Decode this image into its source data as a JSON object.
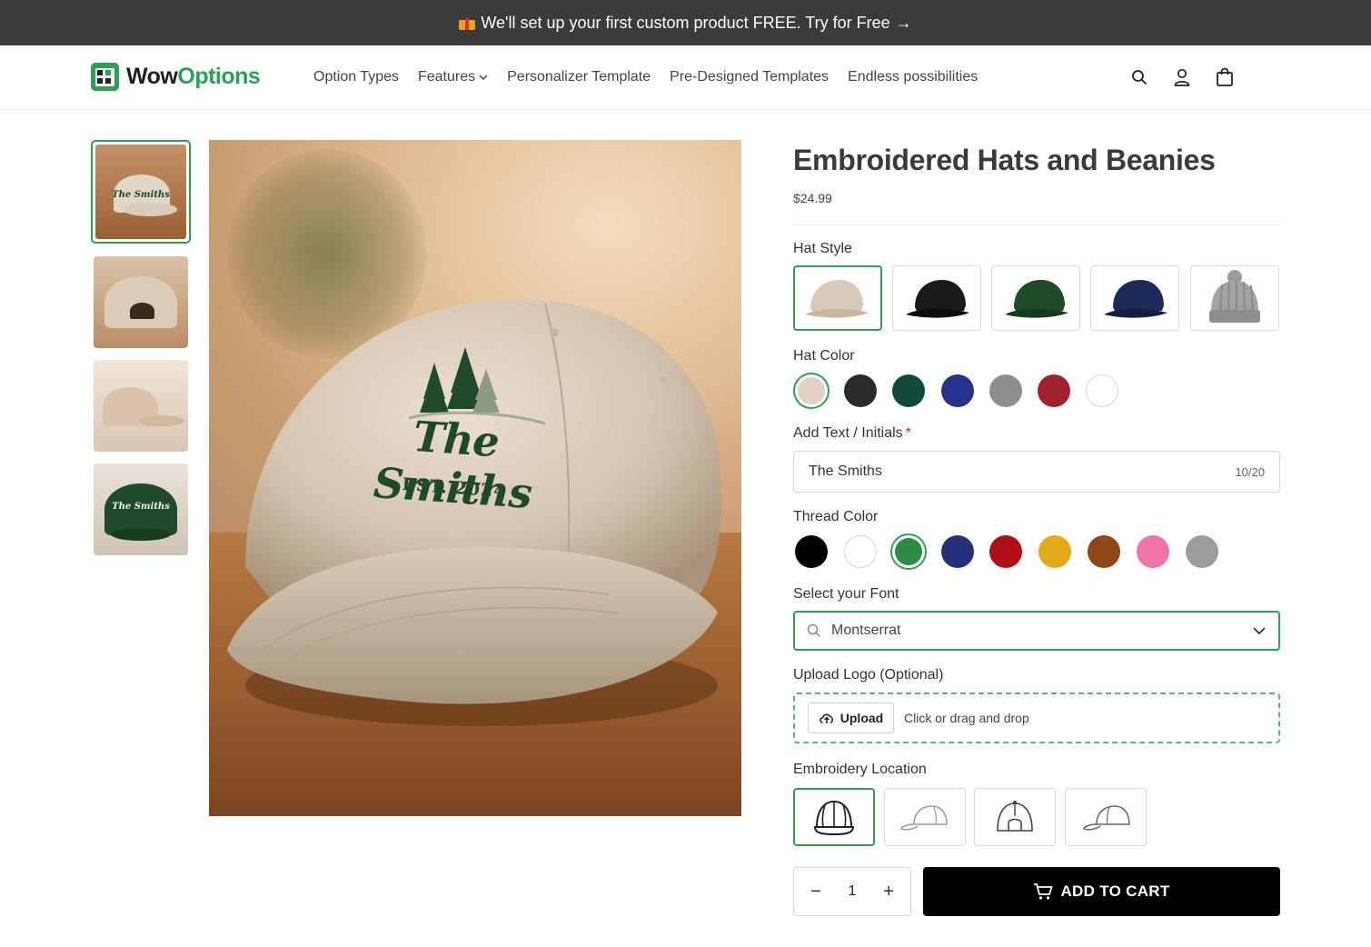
{
  "announcement": {
    "text": "We'll set up your first custom product FREE. Try for Free",
    "arrow": "→"
  },
  "brand": {
    "name_part1": "Wow",
    "name_part2": "Options",
    "accent": "#2f9e56"
  },
  "nav": {
    "items": [
      {
        "label": "Option Types"
      },
      {
        "label": "Features",
        "has_dropdown": true
      },
      {
        "label": "Personalizer Template"
      },
      {
        "label": "Pre-Designed Templates"
      },
      {
        "label": "Endless possibilities"
      }
    ],
    "icons": [
      "search-icon",
      "account-icon",
      "cart-bag-icon"
    ]
  },
  "gallery": {
    "thumbnails": [
      {
        "alt": "Beige cap front",
        "selected": true,
        "caption": "The Smiths"
      },
      {
        "alt": "Beige cap back",
        "selected": false,
        "caption": ""
      },
      {
        "alt": "Beige cap side",
        "selected": false,
        "caption": ""
      },
      {
        "alt": "Green cap front",
        "selected": false,
        "caption": "The Smiths"
      }
    ],
    "main": {
      "embroidery_text": "The Smiths",
      "embroidery_sub": "EST. 2024"
    }
  },
  "product": {
    "title": "Embroidered Hats and Beanies",
    "price": "$24.99"
  },
  "options": {
    "hat_style": {
      "label": "Hat Style",
      "choices": [
        {
          "name": "beige-cap",
          "color": "#d8cab8",
          "selected": true
        },
        {
          "name": "black-cap",
          "color": "#1a1a1a",
          "selected": false
        },
        {
          "name": "green-cap",
          "color": "#1f4a28",
          "selected": false
        },
        {
          "name": "navy-cap",
          "color": "#1d2a57",
          "selected": false
        },
        {
          "name": "gray-beanie",
          "color": "#9a9a9a",
          "selected": false
        }
      ]
    },
    "hat_color": {
      "label": "Hat Color",
      "choices": [
        {
          "color": "#e2d2c6",
          "selected": true
        },
        {
          "color": "#2b2b2b",
          "selected": false
        },
        {
          "color": "#0f4a3c",
          "selected": false
        },
        {
          "color": "#27308a",
          "selected": false
        },
        {
          "color": "#8e8e8e",
          "selected": false
        },
        {
          "color": "#a1222e",
          "selected": false
        },
        {
          "color": "#ffffff",
          "selected": false
        }
      ]
    },
    "text": {
      "label": "Add Text / Initials",
      "required_mark": "*",
      "value": "The Smiths",
      "counter": "10/20"
    },
    "thread_color": {
      "label": "Thread Color",
      "choices": [
        {
          "color": "#000000",
          "selected": false
        },
        {
          "color": "#ffffff",
          "selected": false
        },
        {
          "color": "#2f8a44",
          "selected": true
        },
        {
          "color": "#25307a",
          "selected": false
        },
        {
          "color": "#b10f16",
          "selected": false
        },
        {
          "color": "#e2aa18",
          "selected": false
        },
        {
          "color": "#8f4715",
          "selected": false
        },
        {
          "color": "#ee73a8",
          "selected": false
        },
        {
          "color": "#9c9c9c",
          "selected": false
        }
      ]
    },
    "font": {
      "label": "Select your Font",
      "value": "Montserrat"
    },
    "logo": {
      "label": "Upload Logo (Optional)",
      "button": "Upload",
      "hint": "Click or drag and drop"
    },
    "location": {
      "label": "Embroidery Location",
      "choices": [
        {
          "name": "front",
          "selected": true
        },
        {
          "name": "side-left",
          "selected": false
        },
        {
          "name": "back",
          "selected": false
        },
        {
          "name": "side-right",
          "selected": false
        }
      ]
    }
  },
  "purchase": {
    "quantity": "1",
    "minus": "−",
    "plus": "+",
    "add_to_cart": "ADD TO CART"
  }
}
